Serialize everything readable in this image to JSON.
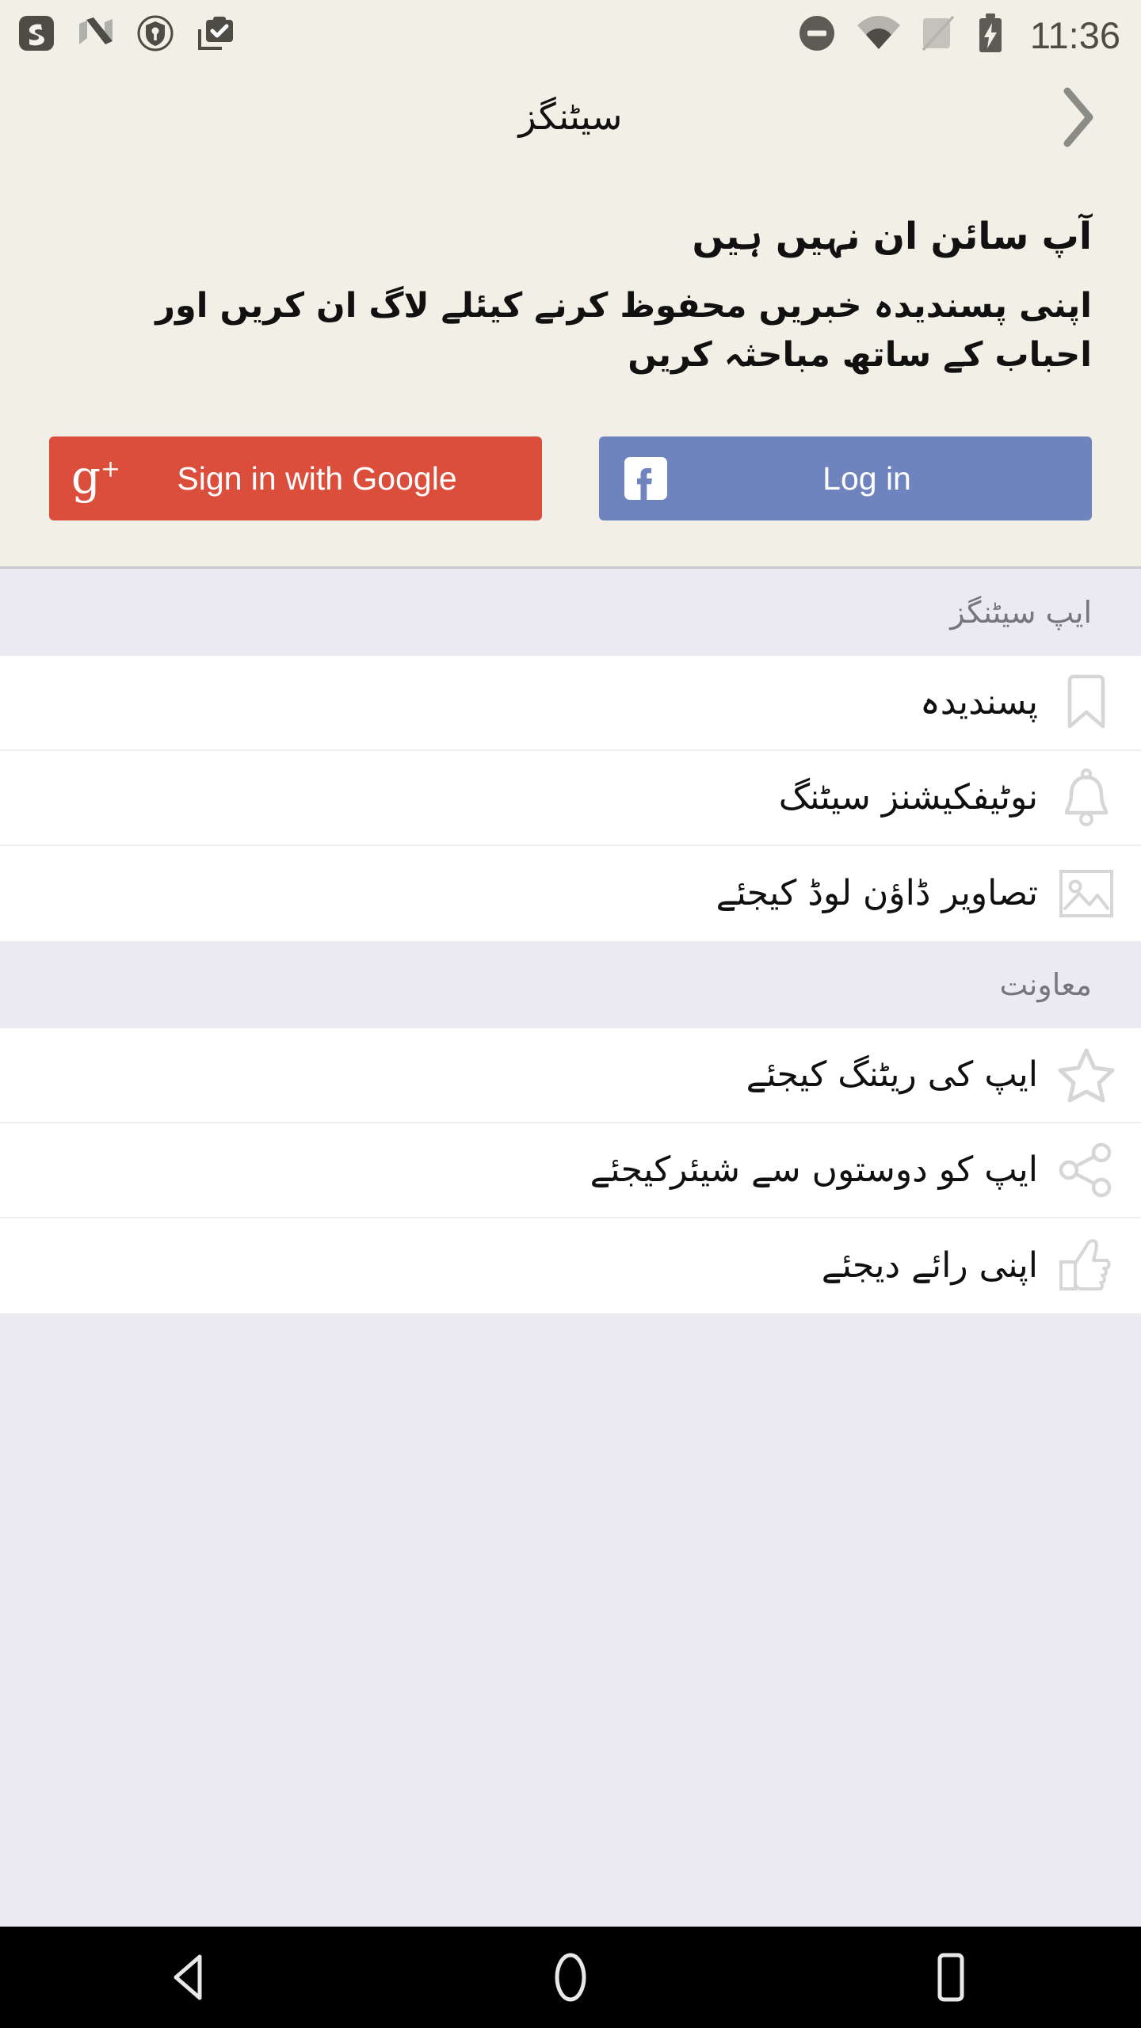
{
  "status_bar": {
    "notification_icons": [
      "app-badge-icon",
      "android-nougat-icon",
      "shield-key-icon",
      "work-profile-briefcase-icon"
    ],
    "do_not_disturb_icon": "do-not-disturb-icon",
    "wifi_icon": "wifi-icon",
    "signal_off_icon": "cellular-signal-off-icon",
    "battery_icon": "battery-charging-icon",
    "time": "11:36"
  },
  "appbar": {
    "title": "سیٹنگز",
    "nav_icon": "chevron-right-icon"
  },
  "signin": {
    "title": "آپ سائن ان نہیں ہیں",
    "subtitle": "اپنی پسندیدہ خبریں محفوظ کرنے کیئلے لاگ ان کریں اور احباب کے ساتھ مباحثہ کریں",
    "google_button": {
      "label": "Sign in with Google",
      "icon": "google-plus-icon",
      "color": "#dc4e3c",
      "glyph": "g"
    },
    "facebook_button": {
      "label": "Log in",
      "icon": "facebook-icon",
      "color": "#6f84bf",
      "glyph": "f"
    }
  },
  "sections": [
    {
      "header": "ایپ سیٹنگز",
      "rows": [
        {
          "label": "پسندیدہ",
          "icon": "bookmark-icon"
        },
        {
          "label": "نوٹیفکیشنز سیٹنگ",
          "icon": "bell-icon"
        },
        {
          "label": "تصاویر ڈاؤن لوڈ کیجئے",
          "icon": "image-placeholder-icon"
        }
      ]
    },
    {
      "header": "معاونت",
      "rows": [
        {
          "label": "ایپ کی ریٹنگ کیجئے",
          "icon": "star-outline-icon"
        },
        {
          "label": "ایپ کو دوستوں سے شیئرکیجئے",
          "icon": "share-icon"
        },
        {
          "label": "اپنی رائے دیجئے",
          "icon": "thumbs-up-icon"
        }
      ]
    }
  ],
  "bottom_partial_section": {
    "header": ""
  },
  "navbar": {
    "back_icon": "back-triangle-icon",
    "home_icon": "home-circle-icon",
    "recents_icon": "recents-square-icon"
  },
  "colors": {
    "panel_bg": "#f2efe6",
    "section_bg": "#eaeaf0",
    "row_bg": "#ffffff",
    "icon_gray": "#d6d6d6",
    "section_text": "#76767e",
    "google_red": "#dc4e3c",
    "facebook_blue": "#6f84bf"
  }
}
